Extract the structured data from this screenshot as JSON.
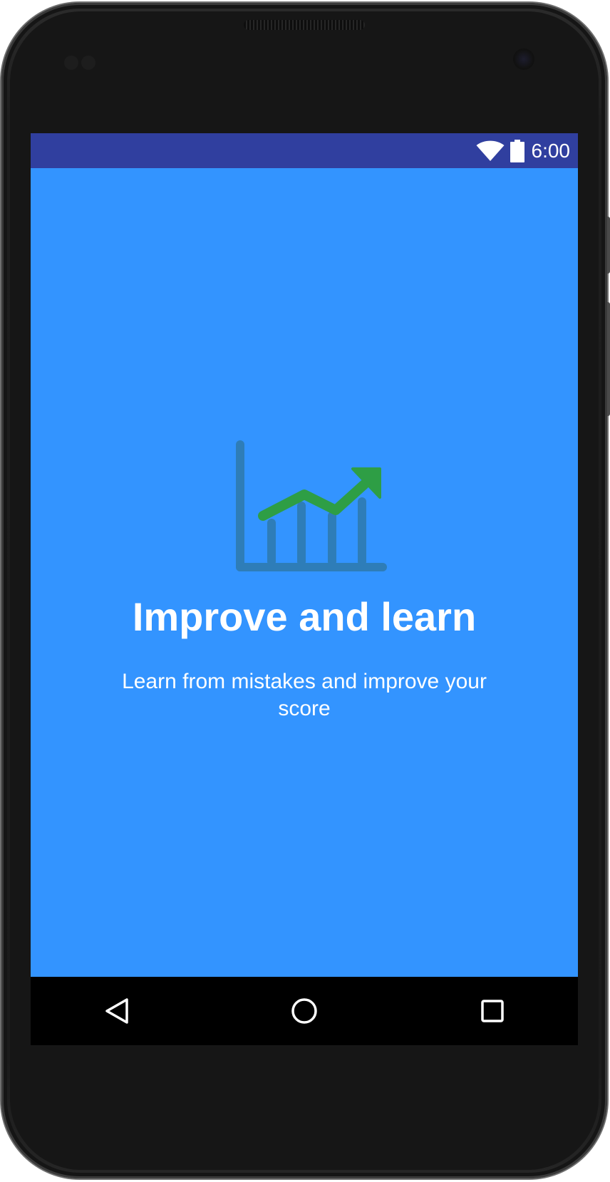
{
  "status_bar": {
    "time": "6:00",
    "icons": [
      "wifi-icon",
      "battery-icon"
    ],
    "background": "#303f9f"
  },
  "onboarding": {
    "icon": "chart-growth-icon",
    "title": "Improve and learn",
    "subtitle": "Learn from mistakes and improve your score",
    "background": "#3394ff",
    "chart_color": "#2e7db8",
    "arrow_color": "#2e9e45"
  },
  "nav_bar": {
    "buttons": [
      "back-icon",
      "home-icon",
      "recents-icon"
    ]
  }
}
